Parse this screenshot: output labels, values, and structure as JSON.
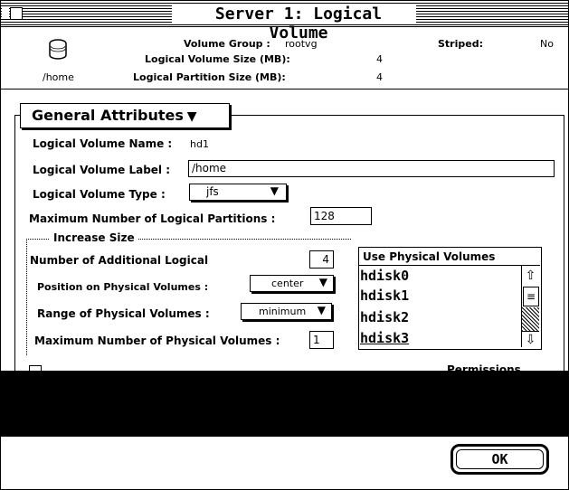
{
  "window": {
    "title": "Server 1: Logical Volume"
  },
  "header": {
    "icon_label": "/home",
    "volume_group_label": "Volume Group :",
    "volume_group_value": "rootvg",
    "lv_size_label": "Logical Volume Size (MB):",
    "lv_size_value": "4",
    "lp_size_label": "Logical Partition Size (MB):",
    "lp_size_value": "4",
    "striped_label": "Striped:",
    "striped_value": "No"
  },
  "section": {
    "title": "General Attributes"
  },
  "form": {
    "lv_name_label": "Logical Volume Name :",
    "lv_name_value": "hd1",
    "lv_label_label": "Logical Volume Label :",
    "lv_label_value": "/home",
    "lv_type_label": "Logical Volume Type :",
    "lv_type_value": "jfs",
    "max_lp_label": "Maximum Number of Logical Partitions :",
    "max_lp_value": "128"
  },
  "increase": {
    "group_title": "Increase Size",
    "additional_label": "Number of Additional Logical",
    "additional_value": "4",
    "position_label": "Position on Physical Volumes :",
    "position_value": "center",
    "range_label": "Range of Physical Volumes :",
    "range_value": "minimum",
    "max_pv_label": "Maximum Number of Physical Volumes :",
    "max_pv_value": "1"
  },
  "physical_volumes": {
    "header": "Use Physical Volumes",
    "items": [
      "hdisk0",
      "hdisk1",
      "hdisk2",
      "hdisk3"
    ]
  },
  "permissions_label": "Permissions",
  "buttons": {
    "ok": "OK"
  }
}
